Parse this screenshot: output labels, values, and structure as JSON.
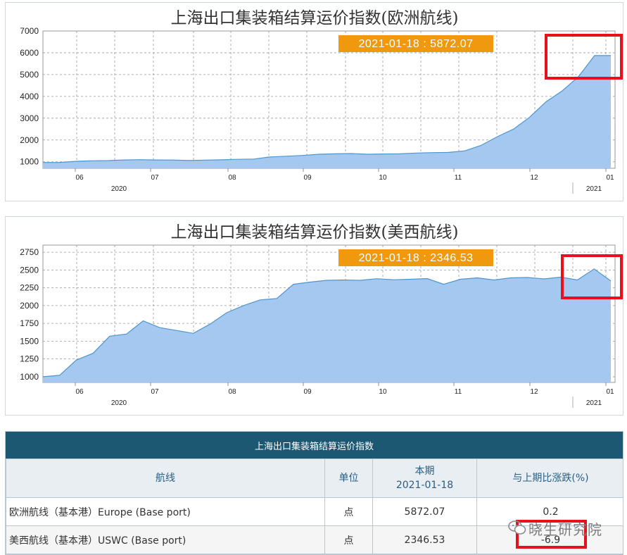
{
  "colors": {
    "fill": "#a4c8f0",
    "stroke": "#4f95cc",
    "tooltip": "#f0990e",
    "header": "#1d5873",
    "highlight": "#e8101a"
  },
  "chart_data": [
    {
      "type": "area",
      "title": "上海出口集装箱结算运价指数(欧洲航线)",
      "tooltip": "2021-01-18 : 5872.07",
      "ylim": [
        700,
        7000
      ],
      "y_ticks": [
        "7000",
        "6000",
        "5000",
        "4000",
        "3000",
        "2000",
        "1000"
      ],
      "x_month_labels": [
        "06",
        "07",
        "08",
        "09",
        "10",
        "11",
        "12",
        "01"
      ],
      "x_year_labels": [
        "2020",
        "2021"
      ],
      "grid": true,
      "series": [
        {
          "values": [
            968,
            972,
            1020,
            1045,
            1055,
            1085,
            1098,
            1085,
            1080,
            1060,
            1079,
            1090,
            1115,
            1128,
            1223,
            1255,
            1290,
            1345,
            1365,
            1380,
            1345,
            1360,
            1365,
            1400,
            1420,
            1430,
            1500,
            1750,
            2150,
            2500,
            3050,
            3750,
            4250,
            4900,
            5872,
            5872
          ]
        }
      ]
    },
    {
      "type": "area",
      "title": "上海出口集装箱结算运价指数(美西航线)",
      "tooltip": "2021-01-18 : 2346.53",
      "ylim": [
        920,
        2850
      ],
      "y_ticks": [
        "2750",
        "2500",
        "2250",
        "2000",
        "1750",
        "1500",
        "1250",
        "1000"
      ],
      "x_month_labels": [
        "06",
        "07",
        "08",
        "09",
        "10",
        "11",
        "12",
        "01"
      ],
      "x_year_labels": [
        "2020",
        "2021"
      ],
      "grid": true,
      "series": [
        {
          "values": [
            1000,
            1020,
            1235,
            1330,
            1570,
            1600,
            1785,
            1690,
            1650,
            1610,
            1740,
            1900,
            2000,
            2080,
            2100,
            2300,
            2330,
            2355,
            2360,
            2355,
            2378,
            2363,
            2370,
            2380,
            2300,
            2370,
            2390,
            2360,
            2390,
            2395,
            2375,
            2400,
            2360,
            2515,
            2346
          ]
        }
      ]
    }
  ],
  "table": {
    "title": "上海出口集装箱结算运价指数",
    "headers": {
      "route": "航线",
      "unit": "单位",
      "period_label": "本期",
      "period_date": "2021-01-18",
      "change": "与上期比涨跌(%)"
    },
    "rows": [
      {
        "route": "欧洲航线（基本港）Europe (Base port)",
        "unit": "点",
        "value": "5872.07",
        "change": "0.2"
      },
      {
        "route": "美西航线（基本港）USWC (Base port)",
        "unit": "点",
        "value": "2346.53",
        "change": "-6.9"
      }
    ]
  },
  "watermark": "晓生研究院"
}
